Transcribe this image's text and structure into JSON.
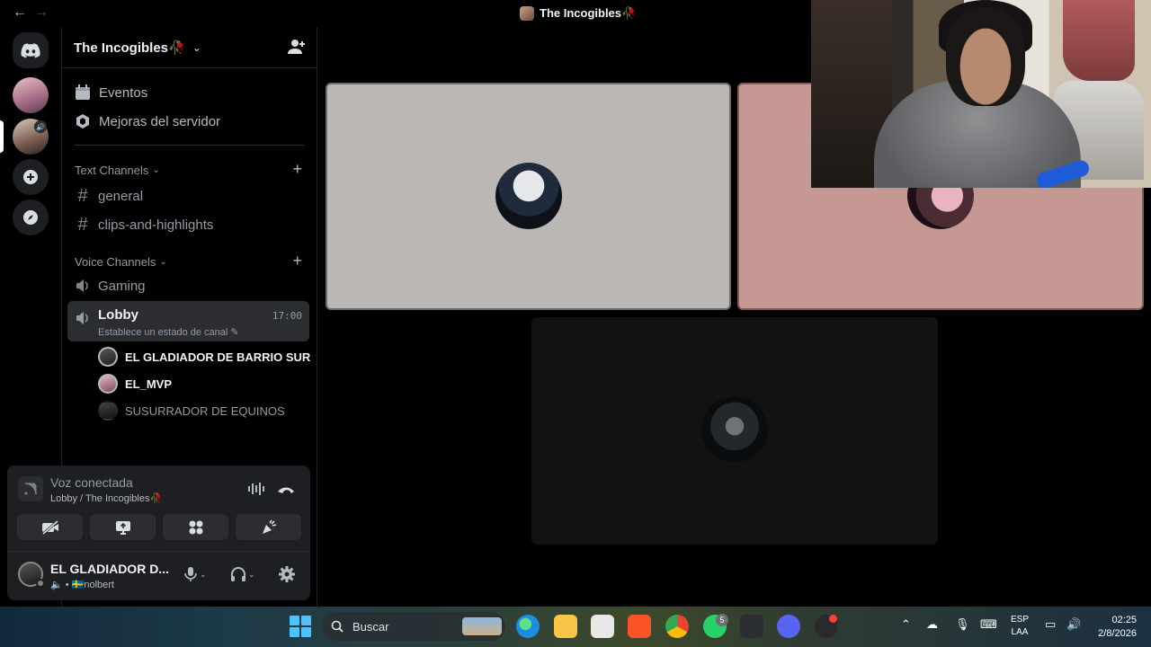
{
  "titlebar": {
    "title": "The Incogibles🥀"
  },
  "server": {
    "name": "The Incogibles🥀"
  },
  "sidebar": {
    "top_items": [
      {
        "label": "Eventos",
        "icon": "calendar-icon"
      },
      {
        "label": "Mejoras del servidor",
        "icon": "boost-icon"
      }
    ],
    "text_category": "Text Channels",
    "text_channels": [
      "general",
      "clips-and-highlights"
    ],
    "voice_category": "Voice Channels",
    "voice_channels": [
      {
        "name": "Gaming"
      },
      {
        "name": "Lobby",
        "status": "Establece un estado de canal",
        "time": "17:00"
      }
    ],
    "voice_users": [
      {
        "name": "EL GLADIADOR DE BARRIO SUR"
      },
      {
        "name": "EL_MVP"
      },
      {
        "name": "SUSURRADOR DE EQUINOS"
      }
    ]
  },
  "voice_panel": {
    "title": "Voz conectada",
    "subtitle": "Lobby / The Incogibles🥀"
  },
  "user_panel": {
    "name": "EL GLADIADOR D...",
    "status": "🔈 • 🇸🇪nolbert"
  },
  "taskbar": {
    "search_placeholder": "Buscar",
    "whatsapp_badge": "5",
    "lang_line1": "ESP",
    "lang_line2": "LAA",
    "time": "02:25",
    "date": "2/8/2026"
  },
  "colors": {
    "accent": "#5865f2",
    "tile1_bg": "#bab7b4",
    "tile2_bg": "#c59893",
    "tile3_bg": "#111214"
  }
}
